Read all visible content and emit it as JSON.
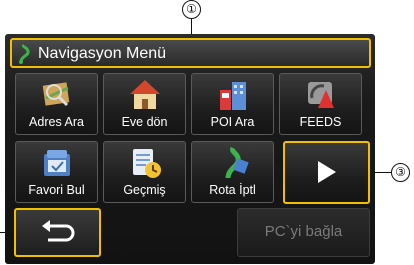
{
  "callouts": {
    "one": "①",
    "three": "③"
  },
  "header": {
    "title": "Navigasyon Menü",
    "icon": "route-icon"
  },
  "menu": {
    "items": [
      {
        "label": "Adres Ara",
        "icon": "map-search-icon"
      },
      {
        "label": "Eve dön",
        "icon": "home-icon"
      },
      {
        "label": "POI Ara",
        "icon": "poi-city-icon"
      },
      {
        "label": "FEEDS",
        "icon": "feeds-icon"
      },
      {
        "label": "Favori Bul",
        "icon": "favorites-icon"
      },
      {
        "label": "Geçmiş",
        "icon": "history-icon"
      },
      {
        "label": "Rota İptl",
        "icon": "cancel-route-icon"
      }
    ],
    "next_icon": "play-next-icon"
  },
  "footer": {
    "back_icon": "back-arrow-icon",
    "pc_connect_label": "PC`yi bağla"
  },
  "colors": {
    "highlight": "#f0c000",
    "background": "#141414",
    "text": "#ffffff",
    "disabled_text": "#7a7a7a"
  }
}
